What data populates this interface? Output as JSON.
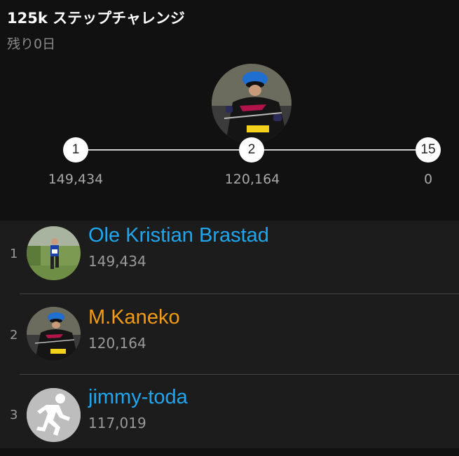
{
  "challenge": {
    "title": "125k ステップチャレンジ",
    "days_left": "残り0日"
  },
  "progress": {
    "markers": [
      {
        "rank": "1",
        "value": "149,434"
      },
      {
        "rank": "2",
        "value": "120,164"
      },
      {
        "rank": "15",
        "value": "0"
      }
    ]
  },
  "leaderboard": [
    {
      "rank": "1",
      "name": "Ole Kristian Brastad",
      "steps": "149,434",
      "name_color": "#1ea7f0"
    },
    {
      "rank": "2",
      "name": "M.Kaneko",
      "steps": "120,164",
      "name_color": "#f39c12"
    },
    {
      "rank": "3",
      "name": "jimmy-toda",
      "steps": "117,019",
      "name_color": "#1ea7f0"
    }
  ]
}
